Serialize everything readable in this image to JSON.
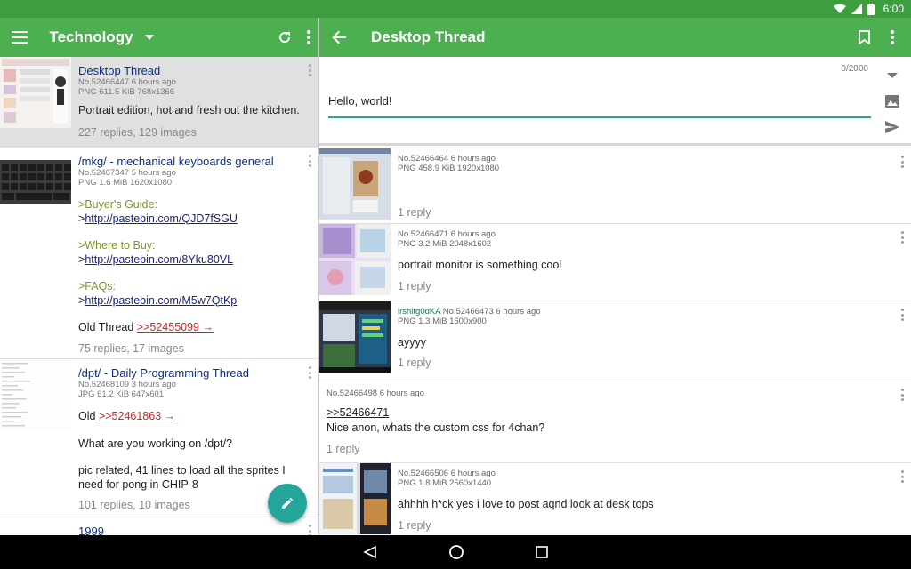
{
  "status": {
    "time": "6:00"
  },
  "left_toolbar": {
    "title": "Technology"
  },
  "right_toolbar": {
    "title": "Desktop Thread"
  },
  "reply": {
    "counter": "0/2000",
    "text": "Hello, world!"
  },
  "threads": [
    {
      "title": "Desktop Thread",
      "meta1": "No.52466447 6 hours ago",
      "meta2": "PNG 611.5 KiB 768x1366",
      "text": "Portrait edition, hot and fresh out the kitchen.",
      "stats": "227 replies, 129 images"
    },
    {
      "title": "/mkg/ - mechanical keyboards general",
      "meta1": "No.52467347 5 hours ago",
      "meta2": "PNG 1.6 MiB 1620x1080",
      "q1": ">Buyer's Guide:",
      "l1": "http://pastebin.com/QJD7fSGU",
      "q2": ">Where to Buy:",
      "l2": "http://pastebin.com/8Yku80VL",
      "q3": ">FAQs:",
      "l3": "http://pastebin.com/M5w7QtKp",
      "old_label": "Old Thread",
      "old_link": ">>52455099 →",
      "stats": "75 replies, 17 images"
    },
    {
      "title": "/dpt/ - Daily Programming Thread",
      "meta1": "No.52468109 3 hours ago",
      "meta2": "JPG 61.2 KiB 647x601",
      "old_label": "Old",
      "old_link": ">>52461863 →",
      "text1": "What are you working on /dpt/?",
      "text2": "pic related, 41 lines to load all the sprites I need for pong in CHIP-8",
      "stats": "101 replies, 10 images"
    },
    {
      "title": "1999"
    }
  ],
  "posts": [
    {
      "meta": "No.52466464 6 hours ago",
      "file": "PNG 458.9 KiB 1920x1080",
      "replies": "1 reply"
    },
    {
      "meta": "No.52466471 6 hours ago",
      "file": "PNG 3.2 MiB 2048x1602",
      "text": "portrait monitor is something cool",
      "replies": "1 reply"
    },
    {
      "name": "lrshitg0dKA",
      "meta": "No.52466473 6 hours ago",
      "file": "PNG 1.3 MiB 1600x900",
      "text": "ayyyy",
      "replies": "1 reply"
    },
    {
      "meta": "No.52466498 6 hours ago",
      "quote": ">>52466471",
      "text": "Nice anon, whats the custom css for 4chan?",
      "replies": "1 reply"
    },
    {
      "meta": "No.52466506 6 hours ago",
      "file": "PNG 1.8 MiB 2560x1440",
      "text": "ahhhh h*ck yes i love to post aqnd look at desk tops",
      "replies": "1 reply"
    }
  ]
}
